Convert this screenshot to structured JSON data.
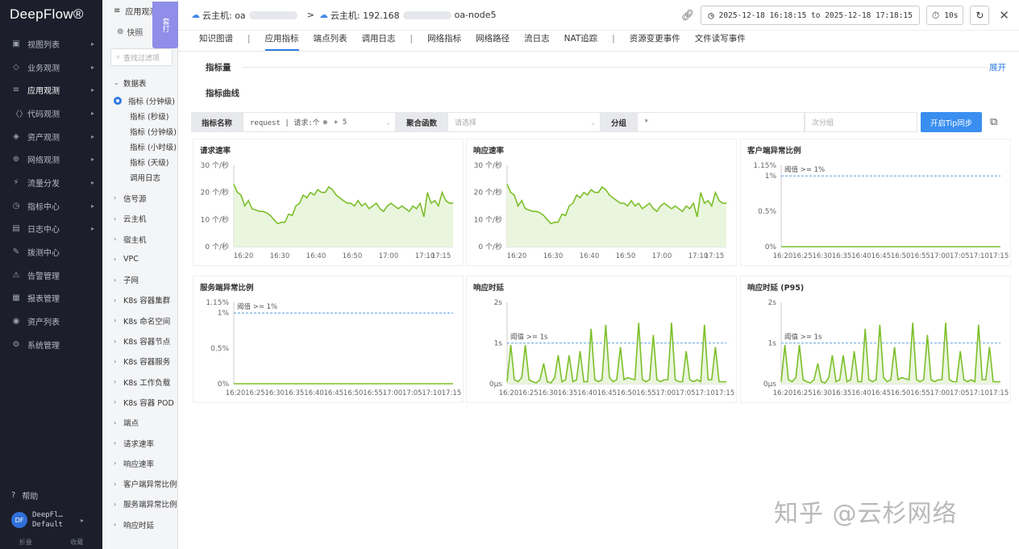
{
  "nav": {
    "logo": "DeepFlow®",
    "items": [
      {
        "icon": "▣",
        "label": "视图列表"
      },
      {
        "icon": "◇",
        "label": "业务观测"
      },
      {
        "icon": "≡",
        "label": "应用观测"
      },
      {
        "icon": "〈〉",
        "label": "代码观测"
      },
      {
        "icon": "◈",
        "label": "资产观测"
      },
      {
        "icon": "⊕",
        "label": "网络观测"
      },
      {
        "icon": "⚡",
        "label": "流量分发"
      },
      {
        "icon": "◷",
        "label": "指标中心"
      },
      {
        "icon": "▤",
        "label": "日志中心"
      },
      {
        "icon": "✎",
        "label": "拨测中心"
      },
      {
        "icon": "⚠",
        "label": "告警管理"
      },
      {
        "icon": "▦",
        "label": "报表管理"
      },
      {
        "icon": "◉",
        "label": "资产列表"
      },
      {
        "icon": "⚙",
        "label": "系统管理"
      }
    ],
    "help": "帮助",
    "avatar": "DF",
    "user_line1": "DeepFl…",
    "user_line2": "Default",
    "collapse_left": "折叠",
    "collapse_right": "收藏"
  },
  "mid": {
    "header": "应用观测",
    "quick": "快照",
    "search_placeholder": "查找过滤项",
    "group": "数据表",
    "selected": "指标 (分钟级)",
    "subs": [
      "指标 (秒级)",
      "指标 (分钟级)",
      "指标 (小时级)",
      "指标 (天级)",
      "调用日志"
    ],
    "items": [
      "信号源",
      "云主机",
      "宿主机",
      "VPC",
      "子网",
      "K8s 容器集群",
      "K8s 命名空间",
      "K8s 容器节点",
      "K8s 容器服务",
      "K8s 工作负载",
      "K8s 容器 POD",
      "端点",
      "请求速率",
      "响应速率",
      "客户端异常比例",
      "服务端异常比例",
      "响应时延"
    ]
  },
  "side_tab": "套打",
  "topbar": {
    "crumb1": "云主机: oa",
    "crumb2": "云主机: 192.168",
    "crumb3": "oa-node5",
    "time_range": "2025-12-18 16:18:15 to 2025-12-18 17:18:15",
    "refresh": "10s"
  },
  "tabs": [
    "知识图谱",
    "应用指标",
    "端点列表",
    "调用日志",
    "网络指标",
    "网络路径",
    "流日志",
    "NAT追踪",
    "资源变更事件",
    "文件读写事件"
  ],
  "active_tab": "应用指标",
  "sections": {
    "metrics": "指标量",
    "expand": "展开",
    "curves": "指标曲线"
  },
  "filter": {
    "metric_label": "指标名称",
    "metric_value": "request | 请求:个",
    "metric_more": "+ 5",
    "agg_label": "聚合函数",
    "agg_placeholder": "请选择",
    "group_label": "分组",
    "group_value": "*",
    "subgroup_placeholder": "次分组",
    "tip_button": "开启Tip同步"
  },
  "colors": {
    "line": "#7cbf2a",
    "fill": "#eaf5dd",
    "threshold": "#3a8ee0",
    "accent": "#2f7ae5"
  },
  "chart_data": [
    {
      "type": "area",
      "title": "请求速率",
      "yticks": [
        "30 个/秒",
        "20 个/秒",
        "10 个/秒",
        "0 个/秒"
      ],
      "ylim": [
        0,
        30
      ],
      "xticks": [
        "16:20",
        "16:30",
        "16:40",
        "16:50",
        "17:00",
        "17:10",
        "17:15"
      ],
      "xlim": [
        16.3,
        17.3
      ],
      "x": [
        16.3,
        16.317,
        16.333,
        16.35,
        16.367,
        16.383,
        16.4,
        16.417,
        16.433,
        16.45,
        16.467,
        16.483,
        16.5,
        16.517,
        16.533,
        16.55,
        16.567,
        16.583,
        16.6,
        16.617,
        16.633,
        16.65,
        16.667,
        16.683,
        16.7,
        16.717,
        16.733,
        16.75,
        16.767,
        16.783,
        16.8,
        16.817,
        16.833,
        16.85,
        16.867,
        16.883,
        16.9,
        16.917,
        16.933,
        16.95,
        16.967,
        16.983,
        17.0,
        17.017,
        17.033,
        17.05,
        17.067,
        17.083,
        17.1,
        17.117,
        17.133,
        17.15,
        17.167,
        17.183,
        17.2,
        17.217,
        17.233,
        17.25,
        17.267,
        17.283,
        17.3
      ],
      "values": [
        23,
        20,
        19,
        15,
        17,
        14,
        13.5,
        13,
        13,
        12.5,
        11.5,
        10,
        8.5,
        9,
        9,
        12,
        11.5,
        15,
        16,
        19,
        18,
        20,
        19,
        21,
        20,
        20,
        22,
        21,
        19,
        18,
        17,
        16,
        16,
        15,
        17,
        15,
        16,
        14,
        15,
        16,
        14,
        13,
        15,
        16,
        15,
        14,
        15,
        14,
        13,
        15,
        14,
        16,
        11,
        20,
        16,
        17,
        15,
        20,
        17,
        16,
        16
      ]
    },
    {
      "type": "area",
      "title": "响应速率",
      "yticks": [
        "30 个/秒",
        "20 个/秒",
        "10 个/秒",
        "0 个/秒"
      ],
      "ylim": [
        0,
        30
      ],
      "xticks": [
        "16:20",
        "16:30",
        "16:40",
        "16:50",
        "17:00",
        "17:10",
        "17:15"
      ],
      "xlim": [
        16.3,
        17.3
      ],
      "x": [
        16.3,
        16.317,
        16.333,
        16.35,
        16.367,
        16.383,
        16.4,
        16.417,
        16.433,
        16.45,
        16.467,
        16.483,
        16.5,
        16.517,
        16.533,
        16.55,
        16.567,
        16.583,
        16.6,
        16.617,
        16.633,
        16.65,
        16.667,
        16.683,
        16.7,
        16.717,
        16.733,
        16.75,
        16.767,
        16.783,
        16.8,
        16.817,
        16.833,
        16.85,
        16.867,
        16.883,
        16.9,
        16.917,
        16.933,
        16.95,
        16.967,
        16.983,
        17.0,
        17.017,
        17.033,
        17.05,
        17.067,
        17.083,
        17.1,
        17.117,
        17.133,
        17.15,
        17.167,
        17.183,
        17.2,
        17.217,
        17.233,
        17.25,
        17.267,
        17.283,
        17.3
      ],
      "values": [
        23,
        20,
        19,
        15,
        17,
        14,
        13.5,
        13,
        13,
        12.5,
        11.5,
        10,
        8.5,
        9,
        9,
        12,
        11.5,
        15,
        16,
        19,
        18,
        20,
        19,
        21,
        20,
        20,
        22,
        21,
        19,
        18,
        17,
        16,
        16,
        15,
        17,
        15,
        16,
        14,
        15,
        16,
        14,
        13,
        15,
        16,
        15,
        14,
        15,
        14,
        13,
        15,
        14,
        16,
        11,
        20,
        16,
        17,
        15,
        20,
        17,
        16,
        16
      ]
    },
    {
      "type": "area",
      "title": "客户端异常比例",
      "yticks": [
        "1.15%",
        "1%",
        "0.5%",
        "0%"
      ],
      "ylim": [
        0,
        1.15
      ],
      "xticks": [
        "16:20",
        "16:25",
        "16:30",
        "16:35",
        "16:40",
        "16:45",
        "16:50",
        "16:55",
        "17:00",
        "17:05",
        "17:10",
        "17:15"
      ],
      "xlim": [
        16.3,
        17.3
      ],
      "threshold": 1,
      "threshold_label": "阈值 >= 1%",
      "x": [
        16.3,
        17.3
      ],
      "values": [
        0,
        0
      ]
    },
    {
      "type": "area",
      "title": "服务端异常比例",
      "yticks": [
        "1.15%",
        "1%",
        "0.5%",
        "0%"
      ],
      "ylim": [
        0,
        1.15
      ],
      "xticks": [
        "16:20",
        "16:25",
        "16:30",
        "16:35",
        "16:40",
        "16:45",
        "16:50",
        "16:55",
        "17:00",
        "17:05",
        "17:10",
        "17:15"
      ],
      "xlim": [
        16.3,
        17.3
      ],
      "threshold": 1,
      "threshold_label": "阈值 >= 1%",
      "x": [
        16.3,
        17.3
      ],
      "values": [
        0,
        0
      ]
    },
    {
      "type": "area",
      "title": "响应时延",
      "yticks": [
        "2s",
        "1s",
        "0μs"
      ],
      "ylim": [
        0,
        2
      ],
      "xticks": [
        "16:20",
        "16:25",
        "16:30",
        "16:35",
        "16:40",
        "16:45",
        "16:50",
        "16:55",
        "17:00",
        "17:05",
        "17:10",
        "17:15"
      ],
      "xlim": [
        16.3,
        17.3
      ],
      "threshold": 1,
      "threshold_label": "阈值 >= 1s",
      "x": [
        16.3,
        16.317,
        16.333,
        16.35,
        16.367,
        16.383,
        16.4,
        16.417,
        16.433,
        16.45,
        16.467,
        16.483,
        16.5,
        16.517,
        16.533,
        16.55,
        16.567,
        16.583,
        16.6,
        16.617,
        16.633,
        16.65,
        16.667,
        16.683,
        16.7,
        16.717,
        16.733,
        16.75,
        16.767,
        16.783,
        16.8,
        16.817,
        16.833,
        16.85,
        16.867,
        16.883,
        16.9,
        16.917,
        16.933,
        16.95,
        16.967,
        16.983,
        17.0,
        17.017,
        17.033,
        17.05,
        17.067,
        17.083,
        17.1,
        17.117,
        17.133,
        17.15,
        17.167,
        17.183,
        17.2,
        17.217,
        17.233,
        17.25,
        17.267,
        17.283,
        17.3
      ],
      "values": [
        0.05,
        0.95,
        0.1,
        0.05,
        0.15,
        0.95,
        0.1,
        0.05,
        0.02,
        0.1,
        0.5,
        0.05,
        0.02,
        0.15,
        0.7,
        0.05,
        0.1,
        0.7,
        0.05,
        0.1,
        0.8,
        0.05,
        0.05,
        1.35,
        0.1,
        0.05,
        0.1,
        1.45,
        0.15,
        0.05,
        0.1,
        0.9,
        0.1,
        0.15,
        0.12,
        0.1,
        1.5,
        0.1,
        0.05,
        0.1,
        1.2,
        0.1,
        0.05,
        0.1,
        0.1,
        1.5,
        0.1,
        0.05,
        0.05,
        0.8,
        0.1,
        0.05,
        0.1,
        0.05,
        1.45,
        0.1,
        0.1,
        0.9,
        0.05,
        0.05,
        0.05
      ]
    },
    {
      "type": "area",
      "title": "响应时延 (P95)",
      "yticks": [
        "2s",
        "1s",
        "0μs"
      ],
      "ylim": [
        0,
        2
      ],
      "xticks": [
        "16:20",
        "16:25",
        "16:30",
        "16:35",
        "16:40",
        "16:45",
        "16:50",
        "16:55",
        "17:00",
        "17:05",
        "17:10",
        "17:15"
      ],
      "xlim": [
        16.3,
        17.3
      ],
      "threshold": 1,
      "threshold_label": "阈值 >= 1s",
      "x": [
        16.3,
        16.317,
        16.333,
        16.35,
        16.367,
        16.383,
        16.4,
        16.417,
        16.433,
        16.45,
        16.467,
        16.483,
        16.5,
        16.517,
        16.533,
        16.55,
        16.567,
        16.583,
        16.6,
        16.617,
        16.633,
        16.65,
        16.667,
        16.683,
        16.7,
        16.717,
        16.733,
        16.75,
        16.767,
        16.783,
        16.8,
        16.817,
        16.833,
        16.85,
        16.867,
        16.883,
        16.9,
        16.917,
        16.933,
        16.95,
        16.967,
        16.983,
        17.0,
        17.017,
        17.033,
        17.05,
        17.067,
        17.083,
        17.1,
        17.117,
        17.133,
        17.15,
        17.167,
        17.183,
        17.2,
        17.217,
        17.233,
        17.25,
        17.267,
        17.283,
        17.3
      ],
      "values": [
        0.05,
        0.95,
        0.1,
        0.05,
        0.15,
        0.95,
        0.1,
        0.05,
        0.02,
        0.1,
        0.5,
        0.05,
        0.02,
        0.15,
        0.7,
        0.05,
        0.1,
        0.7,
        0.05,
        0.1,
        0.8,
        0.05,
        0.05,
        1.35,
        0.1,
        0.05,
        0.1,
        1.45,
        0.15,
        0.05,
        0.1,
        0.9,
        0.1,
        0.15,
        0.12,
        0.1,
        1.5,
        0.1,
        0.05,
        0.1,
        1.2,
        0.1,
        0.05,
        0.1,
        0.1,
        1.5,
        0.1,
        0.05,
        0.05,
        0.8,
        0.1,
        0.05,
        0.1,
        0.05,
        1.45,
        0.1,
        0.1,
        0.9,
        0.05,
        0.05,
        0.05
      ]
    }
  ],
  "watermark": "知乎 @云杉网络"
}
